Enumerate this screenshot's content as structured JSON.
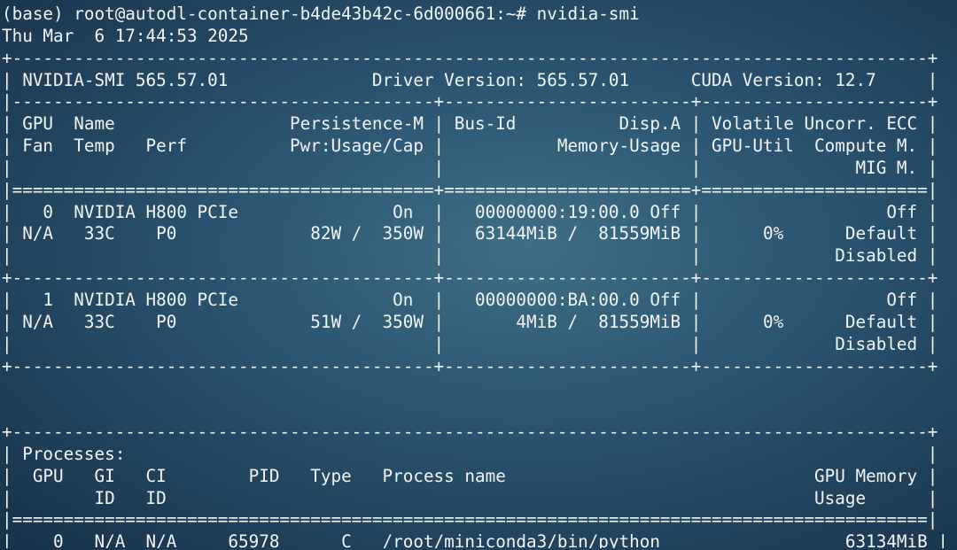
{
  "terminal": {
    "prompt": "(base) root@autodl-container-b4de43b42c-6d000661:~#",
    "command": "nvidia-smi",
    "timestamp": "Thu Mar  6 17:44:53 2025",
    "lines": [
      "+-----------------------------------------------------------------------------------------+",
      "| NVIDIA-SMI 565.57.01              Driver Version: 565.57.01      CUDA Version: 12.7     |",
      "|-----------------------------------------+------------------------+----------------------+",
      "| GPU  Name                 Persistence-M | Bus-Id          Disp.A | Volatile Uncorr. ECC |",
      "| Fan  Temp   Perf          Pwr:Usage/Cap |           Memory-Usage | GPU-Util  Compute M. |",
      "|                                         |                        |               MIG M. |",
      "|=========================================+========================+======================|",
      "|   0  NVIDIA H800 PCIe               On  |   00000000:19:00.0 Off |                  Off |",
      "| N/A   33C    P0             82W /  350W |   63144MiB /  81559MiB |      0%      Default |",
      "|                                         |                        |             Disabled |",
      "+-----------------------------------------+------------------------+----------------------+",
      "|   1  NVIDIA H800 PCIe               On  |   00000000:BA:00.0 Off |                  Off |",
      "| N/A   33C    P0             51W /  350W |       4MiB /  81559MiB |      0%      Default |",
      "|                                         |                        |             Disabled |",
      "+-----------------------------------------+------------------------+----------------------+",
      "",
      "",
      "+-----------------------------------------------------------------------------------------+",
      "| Processes:                                                                              |",
      "|  GPU   GI   CI        PID   Type   Process name                              GPU Memory |",
      "|        ID   ID                                                               Usage      |",
      "|=========================================================================================|",
      "|    0   N/A  N/A     65978      C   /root/miniconda3/bin/python                  63134MiB |",
      "+-----------------------------------------------------------------------------------------+"
    ]
  }
}
